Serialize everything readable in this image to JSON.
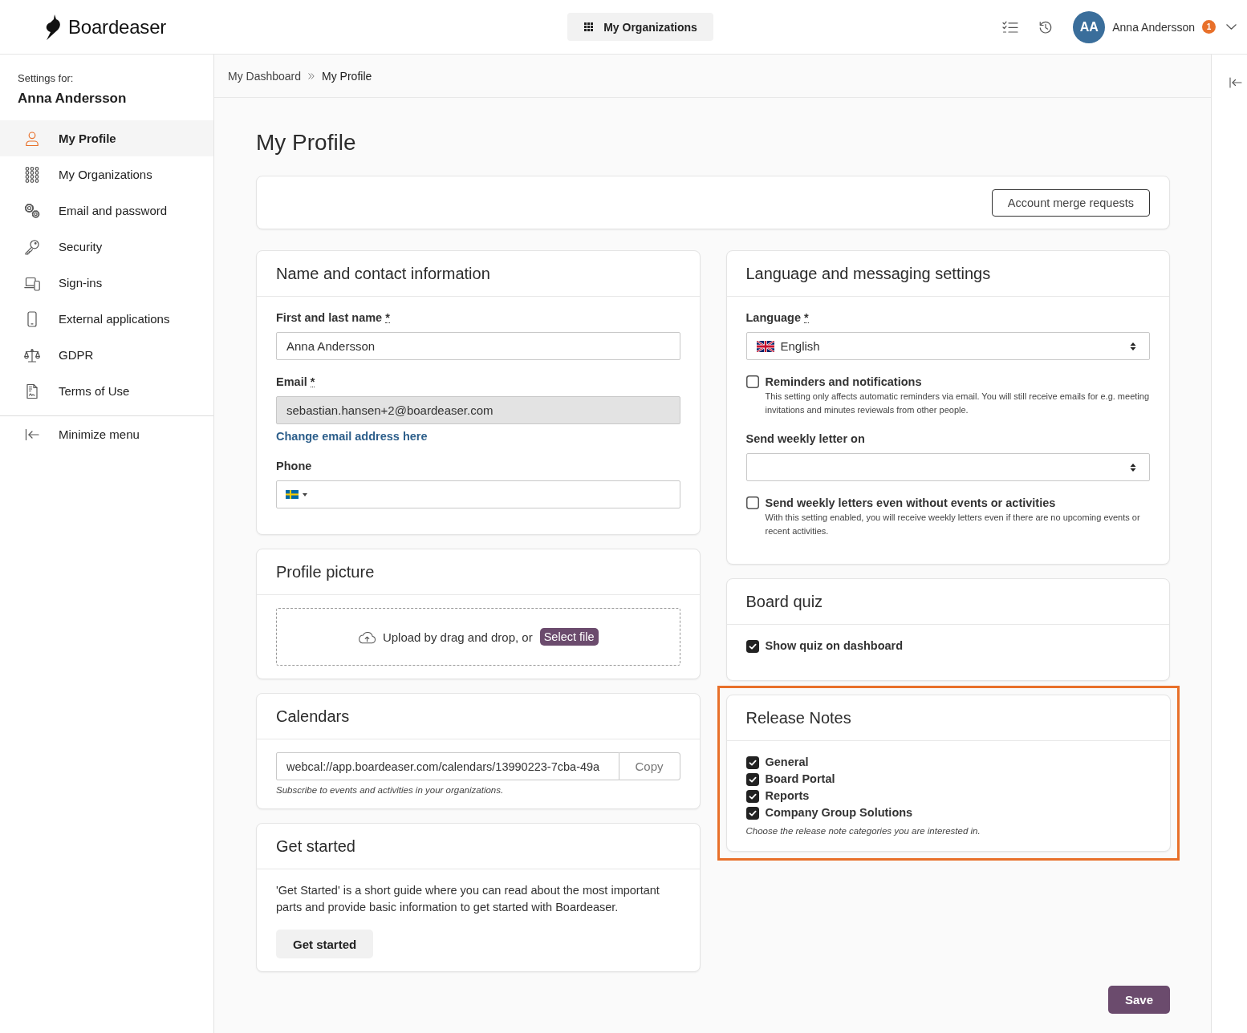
{
  "header": {
    "logo_text": "Boardeaser",
    "org_button": "My Organizations",
    "user": {
      "initials": "AA",
      "name": "Anna Andersson",
      "badge": "1"
    }
  },
  "sidebar": {
    "caption": "Settings for:",
    "user_name": "Anna Andersson",
    "items": [
      {
        "label": "My Profile",
        "selected": true
      },
      {
        "label": "My Organizations",
        "selected": false
      },
      {
        "label": "Email and password",
        "selected": false
      },
      {
        "label": "Security",
        "selected": false
      },
      {
        "label": "Sign-ins",
        "selected": false
      },
      {
        "label": "External applications",
        "selected": false
      },
      {
        "label": "GDPR",
        "selected": false
      },
      {
        "label": "Terms of Use",
        "selected": false
      }
    ],
    "minimize": "Minimize menu"
  },
  "breadcrumb": [
    "My Dashboard",
    "My Profile"
  ],
  "page_title": "My Profile",
  "merge_button": "Account merge requests",
  "contact": {
    "title": "Name and contact information",
    "name_field": {
      "label": "First and last name",
      "required_mark": "*",
      "value": "Anna Andersson",
      "disabled": false
    },
    "email_field": {
      "label": "Email",
      "required_mark": "*",
      "value": "sebastian.hansen+2@boardeaser.com",
      "disabled": true
    },
    "change_email_link": "Change email address here",
    "phone_field": {
      "label": "Phone"
    }
  },
  "profile_picture": {
    "title": "Profile picture",
    "upload_text": "Upload by drag and drop, or",
    "select_button": "Select file"
  },
  "calendars": {
    "title": "Calendars",
    "url": "webcal://app.boardeaser.com/calendars/13990223-7cba-49a",
    "copy_button": "Copy",
    "help": "Subscribe to events and activities in your organizations."
  },
  "get_started": {
    "title": "Get started",
    "text": "'Get Started' is a short guide where you can read about the most important parts and provide basic information to get started with Boardeaser.",
    "button": "Get started"
  },
  "language": {
    "title": "Language and messaging settings",
    "language_select": {
      "label": "Language",
      "required_mark": "*",
      "value": "English"
    },
    "reminders": {
      "label": "Reminders and notifications",
      "checked": false,
      "help": "This setting only affects automatic reminders via email. You will still receive emails for e.g. meeting invitations and minutes reviewals from other people."
    },
    "weekly_select": {
      "label": "Send weekly letter on"
    },
    "weekly_without_events": {
      "label": "Send weekly letters even without events or activities",
      "checked": false,
      "help": "With this setting enabled, you will receive weekly letters even if there are no upcoming events or recent activities."
    }
  },
  "board_quiz": {
    "title": "Board quiz",
    "options": [
      {
        "label": "Show quiz on dashboard",
        "checked": true
      }
    ]
  },
  "release_notes": {
    "title": "Release Notes",
    "highlighted": true,
    "options": [
      {
        "label": "General",
        "checked": true
      },
      {
        "label": "Board Portal",
        "checked": true
      },
      {
        "label": "Reports",
        "checked": true
      },
      {
        "label": "Company Group Solutions",
        "checked": true
      }
    ],
    "help": "Choose the release note categories you are interested in."
  },
  "save_button": "Save"
}
